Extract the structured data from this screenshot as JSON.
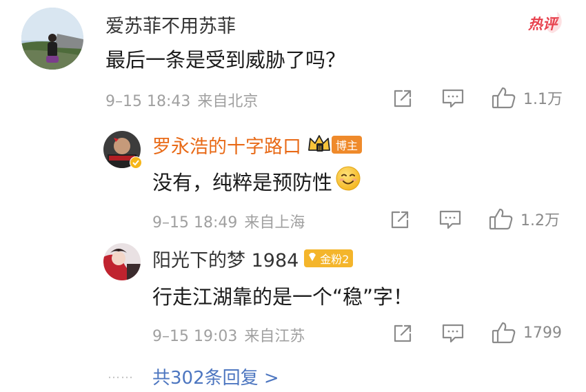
{
  "hot_tag": "热评",
  "main_comment": {
    "username": "爱苏菲不用苏菲",
    "text": "最后一条是受到威胁了吗？",
    "time": "9–15 18:43",
    "location": "来自北京",
    "like_count": "1.1万"
  },
  "replies": [
    {
      "username": "罗永浩的十字路口",
      "badge": "博主",
      "text": "没有，纯粹是预防性",
      "emoji": "smile",
      "time": "9–15 18:49",
      "location": "来自上海",
      "like_count": "1.2万"
    },
    {
      "username": "阳光下的梦 1984",
      "badge": "金粉2",
      "text": "行走江湖靠的是一个“稳”字！",
      "time": "9–15 19:03",
      "location": "来自江苏",
      "like_count": "1799"
    }
  ],
  "more_replies": "共302条回复 >",
  "dots": "……",
  "colors": {
    "accent_name": "#e86a17",
    "link": "#4d76c0",
    "hot_tag": "#e8434f",
    "meta_gray": "#a0a0a0"
  }
}
